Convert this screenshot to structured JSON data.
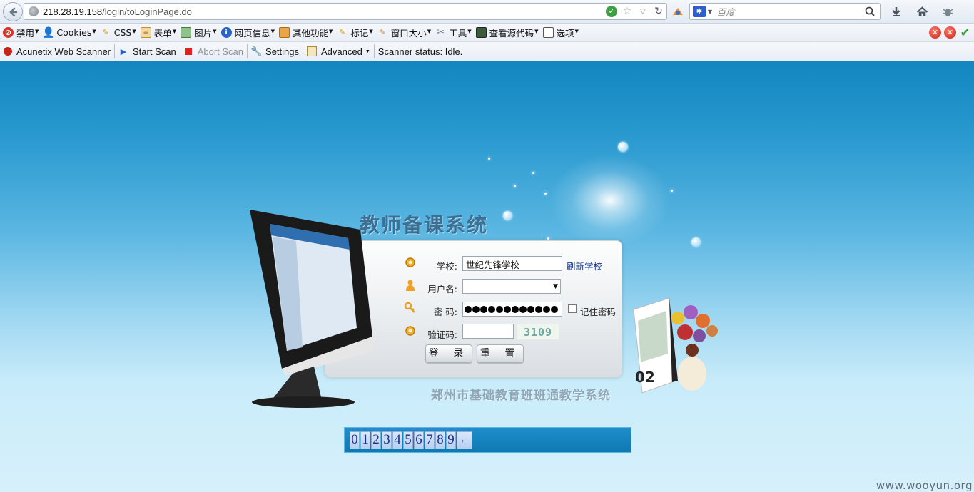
{
  "browser": {
    "url_host": "218.28.19.158",
    "url_path": "/login/toLoginPage.do",
    "search_placeholder": "百度"
  },
  "toolbar1": {
    "items": [
      {
        "label": "禁用",
        "icon": "no-entry-icon",
        "color": "#d9342b"
      },
      {
        "label": "Cookies",
        "icon": "person-icon",
        "color": "#333333"
      },
      {
        "label": "CSS",
        "icon": "pencil-icon",
        "color": "#d4a017"
      },
      {
        "label": "表单",
        "icon": "form-icon",
        "color": "#c8902c"
      },
      {
        "label": "图片",
        "icon": "image-icon",
        "color": "#4a7a3a"
      },
      {
        "label": "网页信息",
        "icon": "info-icon",
        "color": "#2a63c8"
      },
      {
        "label": "其他功能",
        "icon": "book-icon",
        "color": "#c8782c"
      },
      {
        "label": "标记",
        "icon": "highlighter-icon",
        "color": "#d4a017"
      },
      {
        "label": "窗口大小",
        "icon": "ruler-icon",
        "color": "#c8902c"
      },
      {
        "label": "工具",
        "icon": "tools-icon",
        "color": "#6a7480"
      },
      {
        "label": "查看源代码",
        "icon": "source-icon",
        "color": "#3a5a3a"
      },
      {
        "label": "选项",
        "icon": "options-icon",
        "color": "#555555"
      }
    ]
  },
  "toolbar2": {
    "scanner_name": "Acunetix Web Scanner",
    "start_scan": "Start Scan",
    "abort_scan": "Abort Scan",
    "settings": "Settings",
    "advanced": "Advanced",
    "status": "Scanner status: Idle."
  },
  "login": {
    "system_title": "教师备课系统",
    "school_label": "学校:",
    "school_value": "世纪先锋学校",
    "refresh_school": "刷新学校",
    "username_label": "用户名:",
    "username_value": "",
    "password_label": "密 码:",
    "password_dots": 12,
    "remember_label": "记住密码",
    "remember_checked": false,
    "captcha_label": "验证码:",
    "captcha_input": "",
    "captcha_image_text": "3109",
    "login_button": "登 录",
    "reset_button": "重 置",
    "subtitle": "郑州市基础教育班班通教学系统"
  },
  "keypad": {
    "keys": [
      "0",
      "1",
      "2",
      "3",
      "4",
      "5",
      "6",
      "7",
      "8",
      "9"
    ],
    "backspace": "←"
  },
  "calendar_number": "02",
  "watermark": "www.wooyun.org",
  "colors": {
    "page_top": "#1386c0",
    "page_bottom": "#d7f0fb",
    "title": "#3d6f93",
    "link": "#1a3a8c",
    "keypad": "#0f78b3"
  }
}
